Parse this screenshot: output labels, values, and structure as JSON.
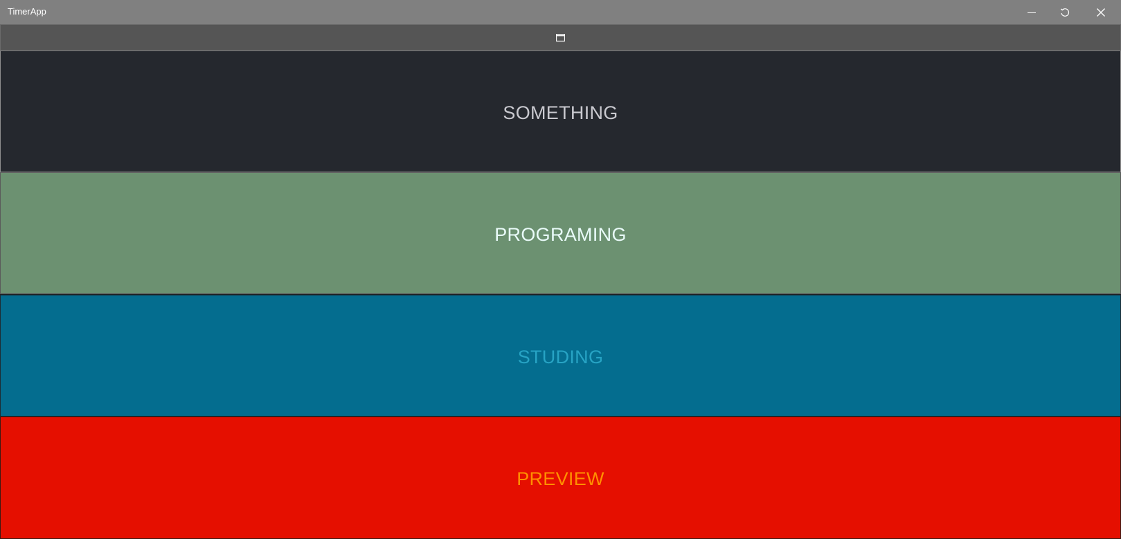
{
  "window": {
    "title": "TimerApp",
    "controls": {
      "minimize_icon": "minimize-icon",
      "restore_icon": "restore-icon",
      "close_icon": "close-icon"
    }
  },
  "toolbar": {
    "icon": "window-icon"
  },
  "panels": [
    {
      "label": "SOMETHING",
      "background": "#25282e",
      "text_color": "#c9c9cf"
    },
    {
      "label": "PROGRAMING",
      "background": "#6c9171",
      "text_color": "#e9fbf9"
    },
    {
      "label": "STUDING",
      "background": "#046d8f",
      "text_color": "#27a3c4"
    },
    {
      "label": "PREVIEW",
      "background": "#e50f00",
      "text_color": "#ff8f00"
    }
  ]
}
